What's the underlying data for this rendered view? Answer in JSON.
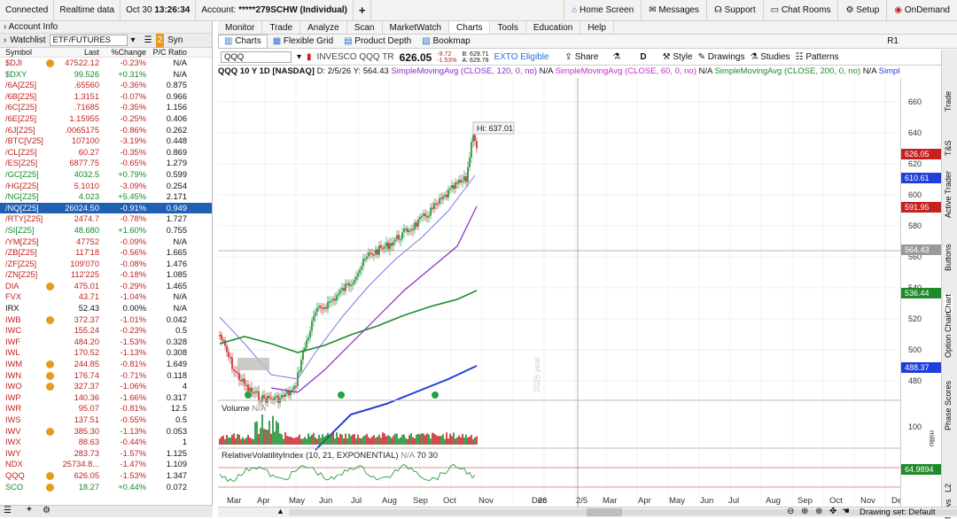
{
  "topbar": {
    "connected": "Connected",
    "realtime": "Realtime data",
    "date": "Oct 30",
    "time": "13:26:34",
    "account_label": "Account:",
    "account_value": "*****279SCHW (Individual)",
    "add": "+",
    "home": "Home Screen",
    "messages": "Messages",
    "support": "Support",
    "chatrooms": "Chat Rooms",
    "setup": "Setup",
    "ondemand": "OnDemand"
  },
  "left": {
    "account_info": "Account Info",
    "watchlist_label": "Watchlist",
    "watchlist_name": "ETF/FUTURES",
    "sync": "Syn",
    "columns": {
      "symbol": "Symbol",
      "last": "Last",
      "pct": "%Change",
      "pc": "P/C Ratio"
    },
    "rows": [
      {
        "sym": "$DJI",
        "badge": true,
        "last": "47522.12",
        "chg": "-0.23%",
        "pc": "N/A",
        "c": "red"
      },
      {
        "sym": "$DXY",
        "badge": false,
        "last": "99.526",
        "chg": "+0.31%",
        "pc": "N/A",
        "c": "grn"
      },
      {
        "sym": "/6A[Z25]",
        "badge": false,
        "last": ".65560",
        "chg": "-0.36%",
        "pc": "0.875",
        "c": "red"
      },
      {
        "sym": "/6B[Z25]",
        "badge": false,
        "last": "1.3151",
        "chg": "-0.07%",
        "pc": "0.966",
        "c": "red"
      },
      {
        "sym": "/6C[Z25]",
        "badge": false,
        "last": ".71685",
        "chg": "-0.35%",
        "pc": "1.156",
        "c": "red"
      },
      {
        "sym": "/6E[Z25]",
        "badge": false,
        "last": "1.15955",
        "chg": "-0.25%",
        "pc": "0.406",
        "c": "red"
      },
      {
        "sym": "/6J[Z25]",
        "badge": false,
        "last": ".0065175",
        "chg": "-0.86%",
        "pc": "0.262",
        "c": "red"
      },
      {
        "sym": "/BTC[V25]",
        "badge": false,
        "last": "107100",
        "chg": "-3.19%",
        "pc": "0.448",
        "c": "red"
      },
      {
        "sym": "/CL[Z25]",
        "badge": false,
        "last": "60.27",
        "chg": "-0.35%",
        "pc": "0.869",
        "c": "red"
      },
      {
        "sym": "/ES[Z25]",
        "badge": false,
        "last": "6877.75",
        "chg": "-0.65%",
        "pc": "1.279",
        "c": "red"
      },
      {
        "sym": "/GC[Z25]",
        "badge": false,
        "last": "4032.5",
        "chg": "+0.79%",
        "pc": "0.599",
        "c": "grn"
      },
      {
        "sym": "/HG[Z25]",
        "badge": false,
        "last": "5.1010",
        "chg": "-3.09%",
        "pc": "0.254",
        "c": "red"
      },
      {
        "sym": "/NG[Z25]",
        "badge": false,
        "last": "4.023",
        "chg": "+5.45%",
        "pc": "2.171",
        "c": "grn"
      },
      {
        "sym": "/NQ[Z25]",
        "badge": false,
        "last": "26024.50",
        "chg": "-0.91%",
        "pc": "0.949",
        "c": "red",
        "selected": true
      },
      {
        "sym": "/RTY[Z25]",
        "badge": false,
        "last": "2474.7",
        "chg": "-0.78%",
        "pc": "1.727",
        "c": "red"
      },
      {
        "sym": "/SI[Z25]",
        "badge": false,
        "last": "48.680",
        "chg": "+1.60%",
        "pc": "0.755",
        "c": "grn"
      },
      {
        "sym": "/YM[Z25]",
        "badge": false,
        "last": "47752",
        "chg": "-0.09%",
        "pc": "N/A",
        "c": "red"
      },
      {
        "sym": "/ZB[Z25]",
        "badge": false,
        "last": "117'18",
        "chg": "-0.56%",
        "pc": "1.665",
        "c": "red"
      },
      {
        "sym": "/ZF[Z25]",
        "badge": false,
        "last": "109'070",
        "chg": "-0.08%",
        "pc": "1.476",
        "c": "red"
      },
      {
        "sym": "/ZN[Z25]",
        "badge": false,
        "last": "112'225",
        "chg": "-0.18%",
        "pc": "1.085",
        "c": "red"
      },
      {
        "sym": "DIA",
        "badge": true,
        "last": "475.01",
        "chg": "-0.29%",
        "pc": "1.465",
        "c": "red"
      },
      {
        "sym": "FVX",
        "badge": false,
        "last": "43.71",
        "chg": "-1.04%",
        "pc": "N/A",
        "c": "red"
      },
      {
        "sym": "IRX",
        "badge": false,
        "last": "52.43",
        "chg": "0.00%",
        "pc": "N/A",
        "c": ""
      },
      {
        "sym": "IWB",
        "badge": true,
        "last": "372.37",
        "chg": "-1.01%",
        "pc": "0.042",
        "c": "red"
      },
      {
        "sym": "IWC",
        "badge": false,
        "last": "155.24",
        "chg": "-0.23%",
        "pc": "0.5",
        "c": "red"
      },
      {
        "sym": "IWF",
        "badge": false,
        "last": "484.20",
        "chg": "-1.53%",
        "pc": "0.328",
        "c": "red"
      },
      {
        "sym": "IWL",
        "badge": false,
        "last": "170.52",
        "chg": "-1.13%",
        "pc": "0.308",
        "c": "red"
      },
      {
        "sym": "IWM",
        "badge": true,
        "last": "244.85",
        "chg": "-0.81%",
        "pc": "1.649",
        "c": "red"
      },
      {
        "sym": "IWN",
        "badge": true,
        "last": "176.74",
        "chg": "-0.71%",
        "pc": "0.118",
        "c": "red"
      },
      {
        "sym": "IWO",
        "badge": true,
        "last": "327.37",
        "chg": "-1.06%",
        "pc": "4",
        "c": "red"
      },
      {
        "sym": "IWP",
        "badge": false,
        "last": "140.36",
        "chg": "-1.66%",
        "pc": "0.317",
        "c": "red"
      },
      {
        "sym": "IWR",
        "badge": false,
        "last": "95.07",
        "chg": "-0.81%",
        "pc": "12.5",
        "c": "red"
      },
      {
        "sym": "IWS",
        "badge": false,
        "last": "137.51",
        "chg": "-0.55%",
        "pc": "0.5",
        "c": "red"
      },
      {
        "sym": "IWV",
        "badge": true,
        "last": "385.30",
        "chg": "-1.13%",
        "pc": "0.053",
        "c": "red"
      },
      {
        "sym": "IWX",
        "badge": false,
        "last": "88.63",
        "chg": "-0.44%",
        "pc": "1",
        "c": "red"
      },
      {
        "sym": "IWY",
        "badge": false,
        "last": "283.73",
        "chg": "-1.57%",
        "pc": "1.125",
        "c": "red"
      },
      {
        "sym": "NDX",
        "badge": false,
        "last": "25734.8...",
        "chg": "-1.47%",
        "pc": "1.109",
        "c": "red"
      },
      {
        "sym": "QQQ",
        "badge": true,
        "last": "626.05",
        "chg": "-1.53%",
        "pc": "1.347",
        "c": "red"
      },
      {
        "sym": "SCO",
        "badge": true,
        "last": "18.27",
        "chg": "+0.44%",
        "pc": "0.072",
        "c": "grn"
      }
    ]
  },
  "nav": {
    "tabs": [
      "Monitor",
      "Trade",
      "Analyze",
      "Scan",
      "MarketWatch",
      "Charts",
      "Tools",
      "Education",
      "Help"
    ],
    "active": "Charts",
    "sub": [
      "Charts",
      "Flexible Grid",
      "Product Depth",
      "Bookmap"
    ],
    "r1": "R1"
  },
  "symbar": {
    "symbol": "QQQ",
    "name": "INVESCO QQQ TR",
    "price": "626.05",
    "chg": "-9.72",
    "chg_pct": "-1.53%",
    "bid": "B: 629.71",
    "ask": "A: 629.78",
    "exto": "EXTO Eligible",
    "share": "Share",
    "period": "D",
    "style": "Style",
    "drawings": "Drawings",
    "studies": "Studies",
    "patterns": "Patterns"
  },
  "studybar": {
    "title": "QQQ 10 Y 1D [NASDAQ]",
    "d": "D: 2/5/26",
    "y": "Y: 564.43",
    "sma1": "SimpleMovingAvg (CLOSE, 120, 0, no)",
    "na": "N/A",
    "sma2": "SimpleMovingAvg (CLOSE, 60, 0, no)",
    "sma3": "SimpleMovingAvg (CLOSE, 200, 0, no)",
    "simple": "Simple..."
  },
  "chart": {
    "hi_label": "Hi: 637.01",
    "watermark": "2025 year",
    "volume_label": "Volume",
    "volume_na": "N/A",
    "rvi_label": "RelativeVolatilityIndex (10, 21, EXPONENTIAL)",
    "rvi_na": "N/A",
    "rvi_70": "70",
    "rvi_30": "30",
    "price_ticks": [
      "660",
      "640",
      "620",
      "600",
      "580",
      "560",
      "540",
      "520",
      "500",
      "480"
    ],
    "vol_tick": "100",
    "vol_unit": "millio",
    "tag_last": "626.05",
    "tag_sma60": "610.61",
    "tag_sma120": "591.95",
    "tag_cursor": "564.43",
    "tag_sma200": "536.44",
    "tag_blue": "488.37",
    "tag_rvi": "64.9894",
    "x_labels": [
      "Mar",
      "Apr",
      "May",
      "Jun",
      "Jul",
      "Aug",
      "Sep",
      "Oct",
      "Nov",
      "Dec",
      "26",
      "2/5",
      "Mar",
      "Apr",
      "May",
      "Jun",
      "Jul",
      "Aug",
      "Sep",
      "Oct",
      "Nov",
      "Dec"
    ],
    "drawing_set": "Drawing set: Default",
    "colors": {
      "up": "#148a2a",
      "down": "#c62020",
      "sma60": "#2a3fd0",
      "sma120": "#8a2ac6",
      "sma200": "#1f8a2a",
      "blue": "#1f3fd8"
    }
  },
  "rail": {
    "items": [
      "Trade",
      "T&S",
      "Active Trader",
      "Buttons",
      "Chart",
      "Option Chain",
      "Phase Scores",
      "L2",
      "News"
    ]
  }
}
